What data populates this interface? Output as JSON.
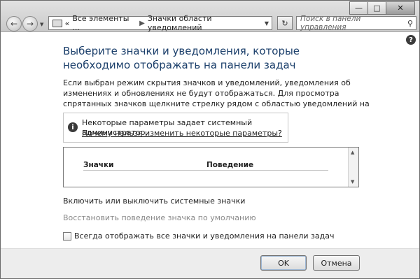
{
  "window_controls": {
    "minimize": "—",
    "maximize": "□",
    "close": "✕"
  },
  "nav": {
    "back_glyph": "←",
    "forward_glyph": "→",
    "dropdown_glyph": "▼",
    "breadcrumb": [
      "Все элементы ...",
      "Значки области уведомлений"
    ],
    "breadcrumb_sep": "▶",
    "address_prefix": "«",
    "address_dropdown": "▼",
    "refresh_glyph": "↻",
    "search_placeholder": "Поиск в панели управления",
    "search_glyph": "⚲"
  },
  "help_glyph": "?",
  "content": {
    "heading": "Выберите значки и уведомления, которые необходимо отображать на панели задач",
    "description": "Если выбран режим скрытия значков и уведомлений, уведомления об изменениях и обновлениях не будут отображаться. Для просмотра спрятанных значков щелкните стрелку рядом с областью уведомлений на панели задач.",
    "info_glyph": "i",
    "info_text": "Некоторые параметры задает системный администратор.",
    "info_link": "Почему нельзя изменить некоторые параметры?",
    "table": {
      "col_icons": "Значки",
      "col_behavior": "Поведение",
      "scroll_up": "▲",
      "scroll_down": "▼"
    },
    "system_icons_link": "Включить или выключить системные значки",
    "restore_link": "Восстановить поведение значка по умолчанию",
    "always_show_label": "Всегда отображать все значки и уведомления на панели задач",
    "always_show_checked": false
  },
  "footer": {
    "ok_label": "OK",
    "cancel_label": "Отмена"
  }
}
